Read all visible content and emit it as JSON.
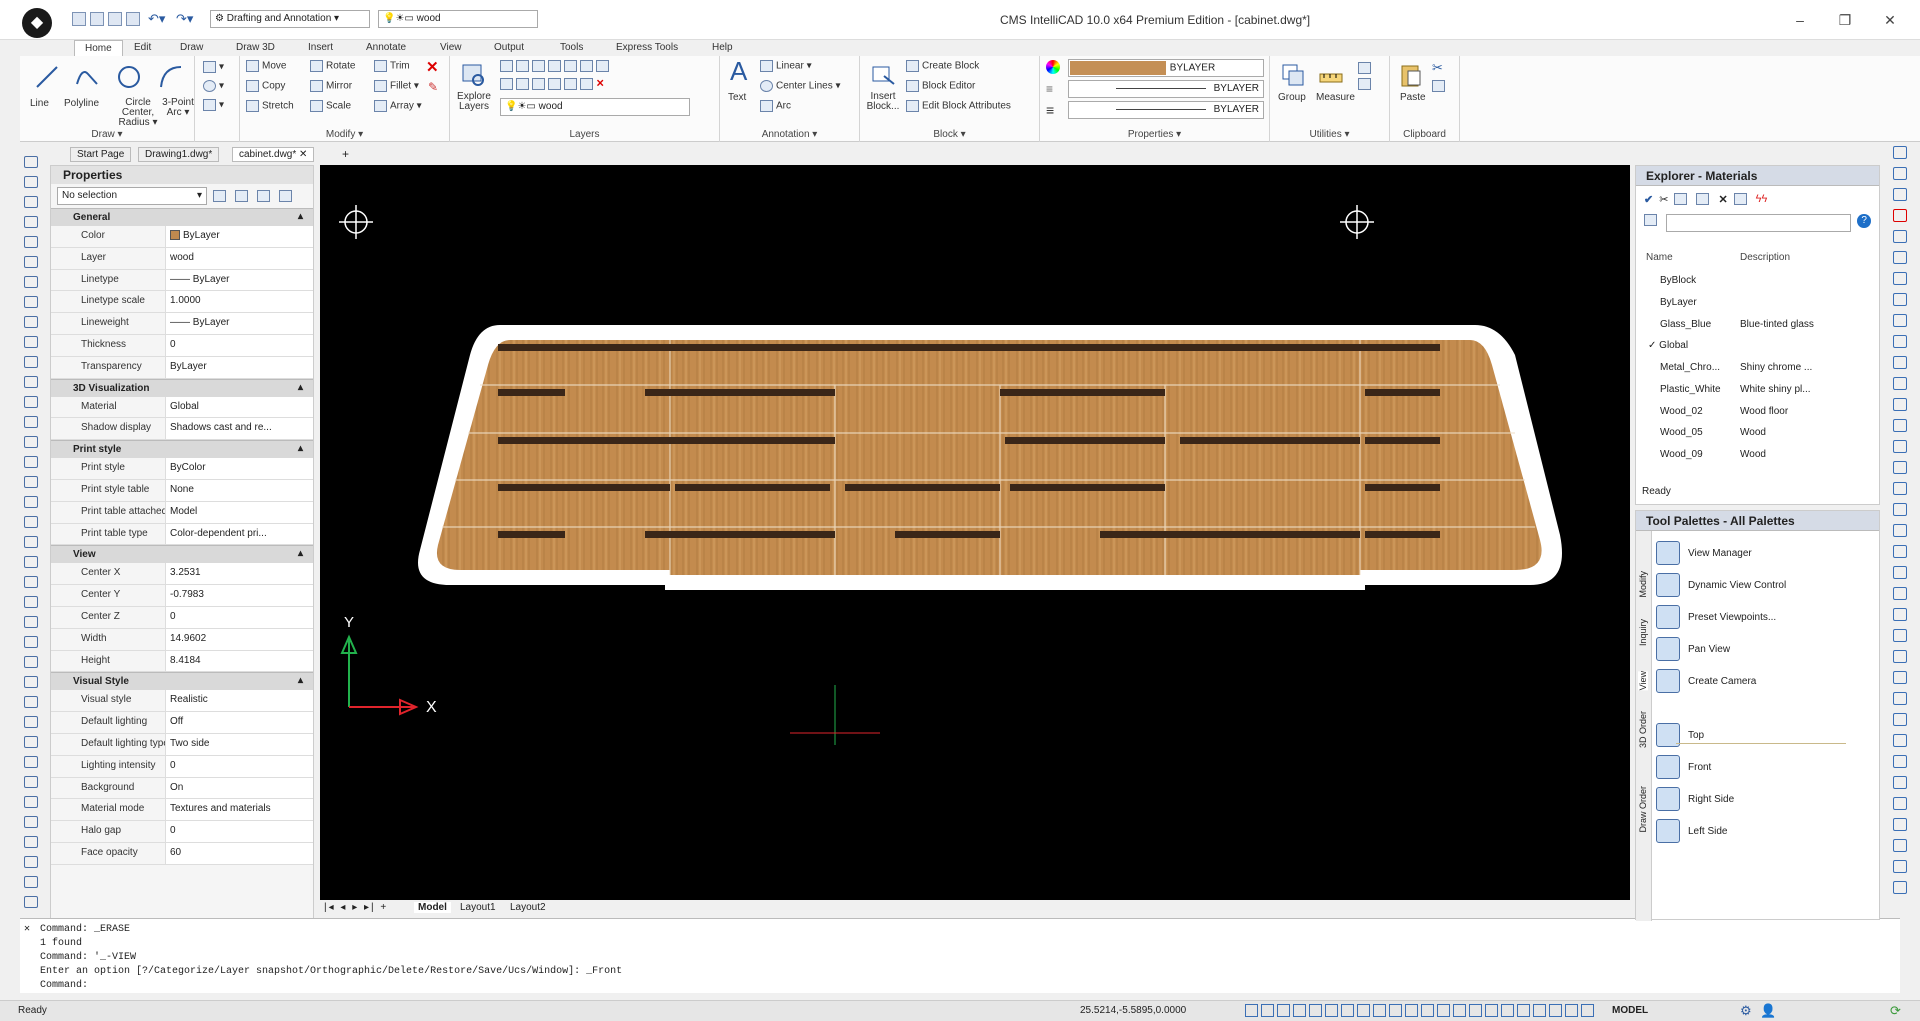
{
  "app": {
    "title": "CMS IntelliCAD 10.0 x64 Premium Edition - [cabinet.dwg*]",
    "workspace": "Drafting and Annotation",
    "layer_combo": "wood",
    "logo_icon": "app-logo-icon"
  },
  "window_controls": {
    "minimize": "–",
    "maximize": "❐",
    "close": "✕"
  },
  "ribbon_tabs": [
    "Home",
    "Edit",
    "Draw",
    "Draw 3D",
    "Insert",
    "Annotate",
    "View",
    "Output",
    "Tools",
    "Express Tools",
    "Help"
  ],
  "ribbon": {
    "draw": {
      "label": "Draw ▾",
      "line": "Line",
      "polyline": "Polyline",
      "circle": "Circle Center, Radius ▾",
      "arc": "3-Point Arc ▾"
    },
    "modify": {
      "label": "Modify ▾",
      "move": "Move",
      "rotate": "Rotate",
      "trim": "Trim",
      "copy": "Copy",
      "mirror": "Mirror",
      "fillet": "Fillet ▾",
      "stretch": "Stretch",
      "scale": "Scale",
      "array": "Array ▾"
    },
    "layers": {
      "label": "Layers",
      "explore": "Explore Layers",
      "layer_value": "wood"
    },
    "annotation": {
      "label": "Annotation ▾",
      "text": "Text",
      "linear": "Linear",
      "center_lines": "Center Lines ▾",
      "arc": "Arc"
    },
    "block": {
      "label": "Block ▾",
      "create": "Create Block",
      "editor": "Block Editor",
      "insert": "Insert Block...",
      "edit_attr": "Edit Block Attributes"
    },
    "properties": {
      "label": "Properties ▾",
      "color": "BYLAYER",
      "linetype": "BYLAYER",
      "lineweight": "BYLAYER"
    },
    "utilities": {
      "label": "Utilities ▾",
      "group": "Group",
      "measure": "Measure"
    },
    "clipboard": {
      "label": "Clipboard",
      "paste": "Paste"
    }
  },
  "doc_tabs": [
    "Start Page",
    "Drawing1.dwg*",
    "cabinet.dwg*"
  ],
  "properties_panel": {
    "title": "Properties",
    "selection": "No selection",
    "sections": [
      {
        "name": "General",
        "rows": [
          [
            "Color",
            "ByLayer"
          ],
          [
            "Layer",
            "wood"
          ],
          [
            "Linetype",
            "—— ByLayer"
          ],
          [
            "Linetype scale",
            "1.0000"
          ],
          [
            "Lineweight",
            "—— ByLayer"
          ],
          [
            "Thickness",
            "0"
          ],
          [
            "Transparency",
            "ByLayer"
          ]
        ]
      },
      {
        "name": "3D Visualization",
        "rows": [
          [
            "Material",
            "Global"
          ],
          [
            "Shadow display",
            "Shadows cast and re..."
          ]
        ]
      },
      {
        "name": "Print style",
        "rows": [
          [
            "Print style",
            "ByColor"
          ],
          [
            "Print style table",
            "None"
          ],
          [
            "Print table attached to",
            "Model"
          ],
          [
            "Print table type",
            "Color-dependent pri..."
          ]
        ]
      },
      {
        "name": "View",
        "rows": [
          [
            "Center X",
            "3.2531"
          ],
          [
            "Center Y",
            "-0.7983"
          ],
          [
            "Center Z",
            "0"
          ],
          [
            "Width",
            "14.9602"
          ],
          [
            "Height",
            "8.4184"
          ]
        ]
      },
      {
        "name": "Visual Style",
        "rows": [
          [
            "Visual style",
            "Realistic"
          ],
          [
            "Default lighting",
            "Off"
          ],
          [
            "Default lighting type",
            "Two side"
          ],
          [
            "Lighting intensity",
            "0"
          ],
          [
            "Background",
            "On"
          ],
          [
            "Material mode",
            "Textures and materials"
          ],
          [
            "Halo gap",
            "0"
          ],
          [
            "Face opacity",
            "60"
          ]
        ]
      }
    ]
  },
  "canvas": {
    "y_axis": "Y",
    "x_axis": "X"
  },
  "layout_tabs": [
    "Model",
    "Layout1",
    "Layout2"
  ],
  "command_lines": [
    "Command: _ERASE",
    "1 found",
    "Command: '_-VIEW",
    "Enter an option [?/Categorize/Layer snapshot/Orthographic/Delete/Restore/Save/Ucs/Window]: _Front",
    "Command:"
  ],
  "explorer": {
    "title": "Explorer - Materials",
    "col_name": "Name",
    "col_desc": "Description",
    "status": "Ready",
    "items": [
      {
        "name": "ByBlock",
        "desc": ""
      },
      {
        "name": "ByLayer",
        "desc": ""
      },
      {
        "name": "Glass_Blue",
        "desc": "Blue-tinted glass"
      },
      {
        "name": "Global",
        "desc": "",
        "checked": true
      },
      {
        "name": "Metal_Chro...",
        "desc": "Shiny chrome ..."
      },
      {
        "name": "Plastic_White",
        "desc": "White shiny pl..."
      },
      {
        "name": "Wood_02",
        "desc": "Wood floor"
      },
      {
        "name": "Wood_05",
        "desc": "Wood"
      },
      {
        "name": "Wood_09",
        "desc": "Wood"
      }
    ]
  },
  "tool_palettes": {
    "title": "Tool Palettes - All Palettes",
    "side_tabs": [
      "Modify",
      "Inquiry",
      "View",
      "3D Order",
      "Draw Order"
    ],
    "items": [
      "View Manager",
      "Dynamic View Control",
      "Preset Viewpoints...",
      "Pan View",
      "Create Camera",
      "Top",
      "Front",
      "Right Side",
      "Left Side"
    ]
  },
  "status": {
    "left": "Ready",
    "coords": "25.5214,-5.5895,0.0000",
    "model": "MODEL"
  },
  "colors": {
    "wood": "#c08a4f",
    "groove": "#3a2618",
    "border": "#ffffff",
    "canvas": "#000000"
  }
}
